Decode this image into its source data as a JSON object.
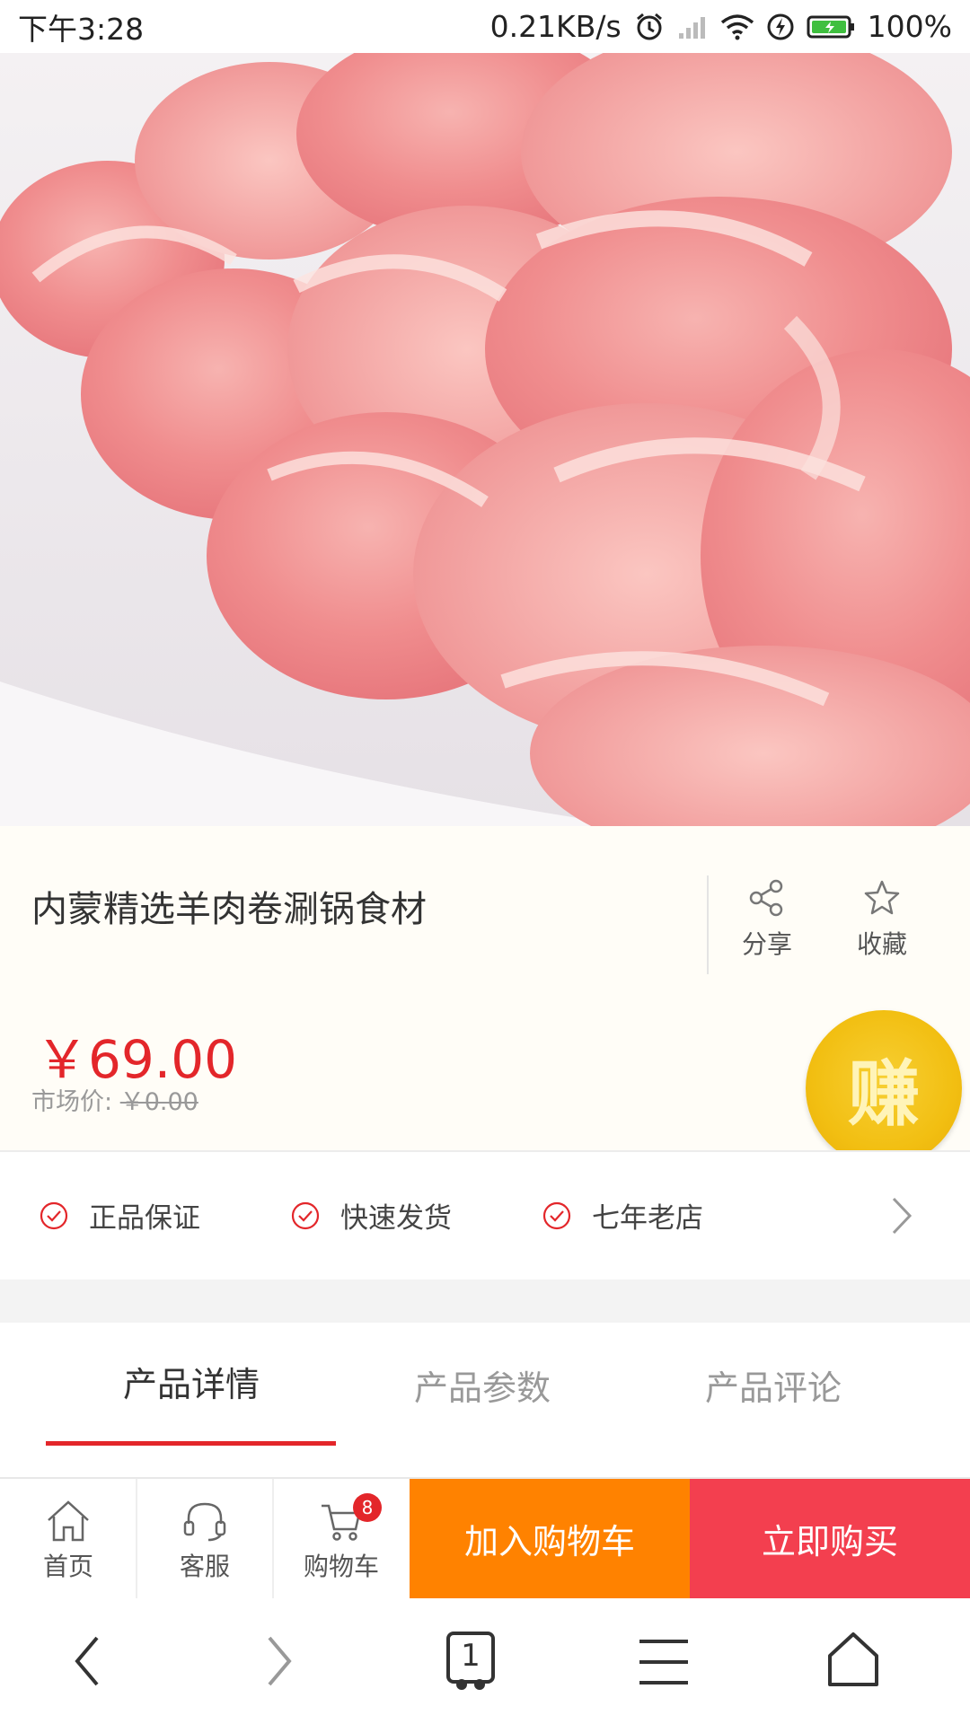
{
  "status_bar": {
    "time": "下午3:28",
    "net_speed": "0.21KB/s",
    "battery": "100%"
  },
  "product": {
    "title": "内蒙精选羊肉卷涮锅食材",
    "price": "￥69.00",
    "market_price_label": "市场价:",
    "market_price_value": "￥0.00",
    "image_icon": "lamb-rolls-photo"
  },
  "actions": {
    "share_label": "分享",
    "favorite_label": "收藏"
  },
  "earn_badge": {
    "label": "赚",
    "color": "#f2bf12"
  },
  "guarantees": [
    {
      "label": "正品保证",
      "icon": "check-circle-icon"
    },
    {
      "label": "快速发货",
      "icon": "check-circle-icon"
    },
    {
      "label": "七年老店",
      "icon": "check-circle-icon"
    }
  ],
  "tabs": [
    {
      "label": "产品详情",
      "active": true
    },
    {
      "label": "产品参数",
      "active": false
    },
    {
      "label": "产品评论",
      "active": false
    }
  ],
  "bottom_bar": {
    "home_label": "首页",
    "service_label": "客服",
    "cart_label": "购物车",
    "cart_count": "8",
    "add_to_cart_label": "加入购物车",
    "buy_now_label": "立即购买"
  },
  "browser_nav": {
    "tab_count": "1"
  },
  "colors": {
    "accent_red": "#e3262a",
    "add_cart_orange": "#ff8200",
    "buy_now_red": "#f33f4f"
  }
}
